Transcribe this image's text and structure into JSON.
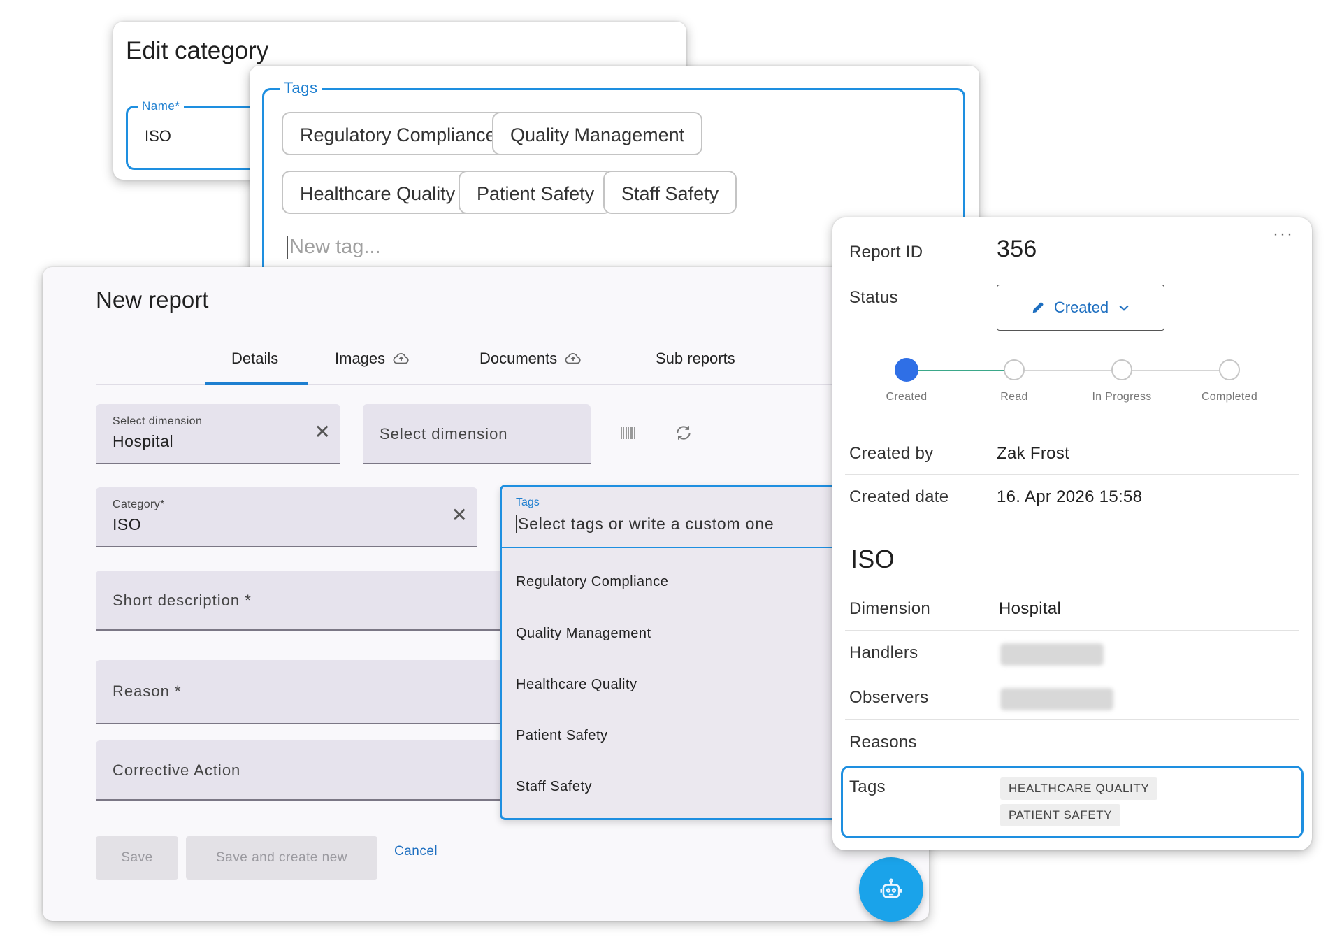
{
  "edit_category": {
    "title": "Edit category",
    "name_label": "Name*",
    "name_value": "ISO"
  },
  "tags_editor": {
    "legend": "Tags",
    "chips": [
      "Regulatory Compliance",
      "Quality Management",
      "Healthcare Quality",
      "Patient Safety",
      "Staff Safety"
    ],
    "new_tag_placeholder": "New tag..."
  },
  "new_report": {
    "title": "New report",
    "tabs": [
      {
        "label": "Details",
        "icon": "none",
        "active": true
      },
      {
        "label": "Images",
        "icon": "cloud-upload-icon"
      },
      {
        "label": "Documents",
        "icon": "cloud-upload-icon"
      },
      {
        "label": "Sub reports",
        "icon": "none"
      }
    ],
    "dimension1": {
      "label": "Select dimension",
      "value": "Hospital"
    },
    "dimension2": {
      "placeholder": "Select dimension"
    },
    "category": {
      "label": "Category*",
      "value": "ISO"
    },
    "short_description": "Short description *",
    "reason": "Reason *",
    "corrective_action": "Corrective Action",
    "tags_select": {
      "label": "Tags",
      "placeholder": "Select tags or write a custom one",
      "options": [
        "Regulatory Compliance",
        "Quality Management",
        "Healthcare Quality",
        "Patient Safety",
        "Staff Safety"
      ]
    },
    "buttons": {
      "save": "Save",
      "save_new": "Save and create new",
      "cancel": "Cancel"
    }
  },
  "report_detail": {
    "report_id_label": "Report ID",
    "report_id": "356",
    "status_label": "Status",
    "status_value": "Created",
    "steps": [
      "Created",
      "Read",
      "In Progress",
      "Completed"
    ],
    "active_step": 0,
    "created_by_label": "Created by",
    "created_by": "Zak Frost",
    "created_date_label": "Created date",
    "created_date": "16. Apr 2026 15:58",
    "category_heading": "ISO",
    "dimension_label": "Dimension",
    "dimension": "Hospital",
    "handlers_label": "Handlers",
    "observers_label": "Observers",
    "reasons_label": "Reasons",
    "tags_label": "Tags",
    "tags": [
      "HEALTHCARE QUALITY",
      "PATIENT SAFETY"
    ]
  },
  "colors": {
    "accent": "#1e8fe0",
    "link": "#1e6fc0",
    "fab": "#1aa3ea",
    "active_step": "#2f6fe6"
  }
}
